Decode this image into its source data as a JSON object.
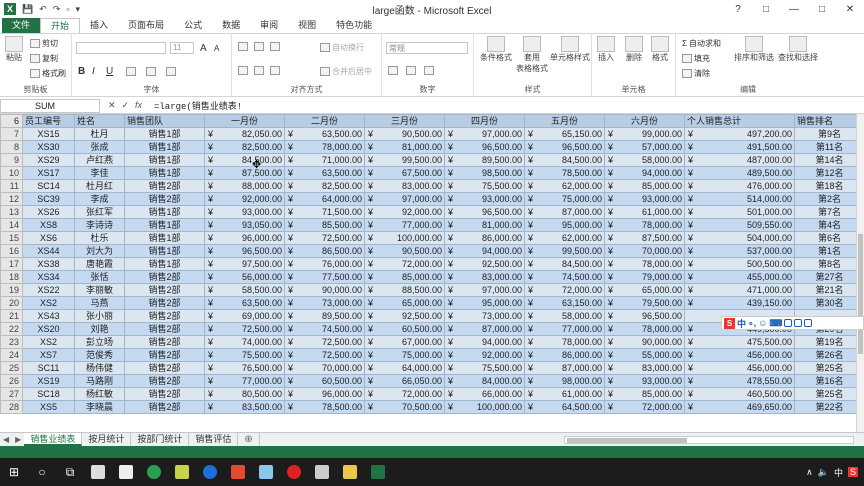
{
  "window": {
    "title": "large函数 - Microsoft Excel",
    "controls": [
      "?",
      "□",
      "—",
      "□",
      "✕"
    ]
  },
  "qat": {
    "logo": "X",
    "items": [
      "💾",
      "↶",
      "↷",
      "▫",
      "▾"
    ]
  },
  "ribbon_tabs": [
    "文件",
    "开始",
    "插入",
    "页面布局",
    "公式",
    "数据",
    "审阅",
    "视图",
    "特色功能"
  ],
  "ribbon": {
    "clipboard": {
      "label": "剪贴板",
      "paste": "粘贴",
      "cut": "剪切",
      "copy": "复制",
      "painter": "格式刷"
    },
    "font": {
      "label": "字体",
      "size": "11",
      "bold": "B",
      "italic": "I",
      "underline": "U",
      "grow": "A",
      "shrink": "A"
    },
    "align": {
      "label": "对齐方式",
      "wrap": "自动换行",
      "merge": "合并后居中"
    },
    "number": {
      "label": "数字",
      "format": "常规"
    },
    "styles": {
      "label": "样式",
      "cond": "条件格式",
      "table": "套用\n表格格式",
      "cell": "单元格样式"
    },
    "cells": {
      "label": "单元格",
      "insert": "插入",
      "delete": "删除",
      "format": "格式"
    },
    "edit": {
      "label": "编辑",
      "autosum": "自动求和",
      "fill": "填充",
      "clear": "清除",
      "sort": "排序和筛选",
      "find": "查找和选择"
    }
  },
  "formula_bar": {
    "name_box": "SUM",
    "icons": [
      "✕",
      "✓",
      "fx"
    ],
    "formula": "=large(销售业绩表!"
  },
  "header": {
    "row": "6",
    "cols": [
      "员工编号",
      "姓名",
      "销售团队",
      "一月份",
      "二月份",
      "三月份",
      "四月份",
      "五月份",
      "六月份",
      "个人销售总计",
      "销售排名"
    ]
  },
  "rows": [
    {
      "r": "7",
      "id": "XS15",
      "name": "杜月",
      "team": "销售1部",
      "m": [
        "82,050.00",
        "63,500.00",
        "90,500.00",
        "97,000.00",
        "65,150.00",
        "99,000.00"
      ],
      "total": "497,200.00",
      "rank": "第9名"
    },
    {
      "r": "8",
      "id": "XS30",
      "name": "张成",
      "team": "销售1部",
      "m": [
        "82,500.00",
        "78,000.00",
        "81,000.00",
        "96,500.00",
        "96,500.00",
        "57,000.00"
      ],
      "total": "491,500.00",
      "rank": "第11名"
    },
    {
      "r": "9",
      "id": "XS29",
      "name": "卢红燕",
      "team": "销售1部",
      "m": [
        "84,500.00",
        "71,000.00",
        "99,500.00",
        "89,500.00",
        "84,500.00",
        "58,000.00"
      ],
      "total": "487,000.00",
      "rank": "第14名"
    },
    {
      "r": "10",
      "id": "XS17",
      "name": "李佳",
      "team": "销售1部",
      "m": [
        "87,500.00",
        "63,500.00",
        "67,500.00",
        "98,500.00",
        "78,500.00",
        "94,000.00"
      ],
      "total": "489,500.00",
      "rank": "第12名"
    },
    {
      "r": "11",
      "id": "SC14",
      "name": "杜月红",
      "team": "销售2部",
      "m": [
        "88,000.00",
        "82,500.00",
        "83,000.00",
        "75,500.00",
        "62,000.00",
        "85,000.00"
      ],
      "total": "476,000.00",
      "rank": "第18名"
    },
    {
      "r": "12",
      "id": "SC39",
      "name": "李成",
      "team": "销售2部",
      "m": [
        "92,000.00",
        "64,000.00",
        "97,000.00",
        "93,000.00",
        "75,000.00",
        "93,000.00"
      ],
      "total": "514,000.00",
      "rank": "第2名"
    },
    {
      "r": "13",
      "id": "XS26",
      "name": "张红军",
      "team": "销售1部",
      "m": [
        "93,000.00",
        "71,500.00",
        "92,000.00",
        "96,500.00",
        "87,000.00",
        "61,000.00"
      ],
      "total": "501,000.00",
      "rank": "第7名"
    },
    {
      "r": "14",
      "id": "XS8",
      "name": "李诗诗",
      "team": "销售1部",
      "m": [
        "93,050.00",
        "85,500.00",
        "77,000.00",
        "81,000.00",
        "95,000.00",
        "78,000.00"
      ],
      "total": "509,550.00",
      "rank": "第4名"
    },
    {
      "r": "15",
      "id": "XS6",
      "name": "杜乐",
      "team": "销售1部",
      "m": [
        "96,000.00",
        "72,500.00",
        "100,000.00",
        "86,000.00",
        "62,000.00",
        "87,500.00"
      ],
      "total": "504,000.00",
      "rank": "第6名"
    },
    {
      "r": "16",
      "id": "XS44",
      "name": "刘大为",
      "team": "销售1部",
      "m": [
        "96,500.00",
        "86,500.00",
        "90,500.00",
        "94,000.00",
        "99,500.00",
        "70,000.00"
      ],
      "total": "537,000.00",
      "rank": "第1名"
    },
    {
      "r": "17",
      "id": "XS38",
      "name": "唐艳霞",
      "team": "销售1部",
      "m": [
        "97,500.00",
        "76,000.00",
        "72,000.00",
        "92,500.00",
        "84,500.00",
        "78,000.00"
      ],
      "total": "500,500.00",
      "rank": "第8名"
    },
    {
      "r": "18",
      "id": "XS34",
      "name": "张恬",
      "team": "销售2部",
      "m": [
        "56,000.00",
        "77,500.00",
        "85,000.00",
        "83,000.00",
        "74,500.00",
        "79,000.00"
      ],
      "total": "455,000.00",
      "rank": "第27名"
    },
    {
      "r": "19",
      "id": "XS22",
      "name": "李丽敏",
      "team": "销售2部",
      "m": [
        "58,500.00",
        "90,000.00",
        "88,500.00",
        "97,000.00",
        "72,000.00",
        "65,000.00"
      ],
      "total": "471,000.00",
      "rank": "第21名"
    },
    {
      "r": "20",
      "id": "XS2",
      "name": "马燕",
      "team": "销售2部",
      "m": [
        "63,500.00",
        "73,000.00",
        "65,000.00",
        "95,000.00",
        "63,150.00",
        "79,500.00"
      ],
      "total": "439,150.00",
      "rank": "第30名"
    },
    {
      "r": "21",
      "id": "XS43",
      "name": "张小丽",
      "team": "销售2部",
      "m": [
        "69,000.00",
        "89,500.00",
        "92,500.00",
        "73,000.00",
        "58,000.00",
        "96,500.00"
      ],
      "total": "",
      "rank": ""
    },
    {
      "r": "22",
      "id": "XS20",
      "name": "刘艳",
      "team": "销售2部",
      "m": [
        "72,500.00",
        "74,500.00",
        "60,500.00",
        "87,000.00",
        "77,000.00",
        "78,000.00"
      ],
      "total": "449,500.00",
      "rank": "第29名"
    },
    {
      "r": "23",
      "id": "XS2",
      "name": "彭立旸",
      "team": "销售2部",
      "m": [
        "74,000.00",
        "72,500.00",
        "67,000.00",
        "94,000.00",
        "78,000.00",
        "90,000.00"
      ],
      "total": "475,500.00",
      "rank": "第19名"
    },
    {
      "r": "24",
      "id": "XS7",
      "name": "范俊秀",
      "team": "销售2部",
      "m": [
        "75,500.00",
        "72,500.00",
        "75,000.00",
        "92,000.00",
        "86,000.00",
        "55,000.00"
      ],
      "total": "456,000.00",
      "rank": "第26名"
    },
    {
      "r": "25",
      "id": "SC11",
      "name": "杨伟健",
      "team": "销售2部",
      "m": [
        "76,500.00",
        "70,000.00",
        "64,000.00",
        "75,500.00",
        "87,000.00",
        "83,000.00"
      ],
      "total": "456,000.00",
      "rank": "第25名"
    },
    {
      "r": "26",
      "id": "XS19",
      "name": "马路刚",
      "team": "销售2部",
      "m": [
        "77,000.00",
        "60,500.00",
        "66,050.00",
        "84,000.00",
        "98,000.00",
        "93,000.00"
      ],
      "total": "478,550.00",
      "rank": "第16名"
    },
    {
      "r": "27",
      "id": "SC18",
      "name": "杨红敏",
      "team": "销售2部",
      "m": [
        "80,500.00",
        "96,000.00",
        "72,000.00",
        "66,000.00",
        "61,000.00",
        "85,000.00"
      ],
      "total": "460,500.00",
      "rank": "第25名"
    },
    {
      "r": "28",
      "id": "XS5",
      "name": "李晓晨",
      "team": "销售2部",
      "m": [
        "83,500.00",
        "78,500.00",
        "70,500.00",
        "100,000.00",
        "64,500.00",
        "72,000.00"
      ],
      "total": "469,650.00",
      "rank": "第22名"
    }
  ],
  "sheet_tabs": {
    "tabs": [
      "销售业绩表",
      "按月统计",
      "按部门统计",
      "销售评估"
    ],
    "active": 0,
    "add": "⊕",
    "arrows": [
      "◀",
      "▶"
    ]
  },
  "ime": {
    "s": "S",
    "items": [
      "中",
      "∘,",
      "☺",
      "⌨"
    ]
  },
  "taskbar": {
    "start": "⊞",
    "search": "○",
    "tasks": "⧉",
    "tray": [
      "∧",
      "🔈",
      "中",
      "S"
    ]
  },
  "colors": {
    "excel_green": "#217346",
    "header_fill": "#b8cce4",
    "odd_fill": "#dce6f1",
    "even_fill": "#c5d9f1"
  }
}
